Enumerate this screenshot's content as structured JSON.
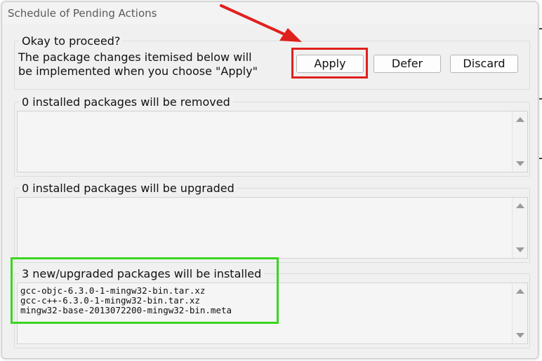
{
  "window": {
    "title": "Schedule of Pending Actions"
  },
  "confirm": {
    "legend": "Okay to proceed?",
    "message_line1": "The package changes itemised below will",
    "message_line2": "be implemented when you choose \"Apply\"",
    "buttons": {
      "apply": "Apply",
      "defer": "Defer",
      "discard": "Discard"
    }
  },
  "removed": {
    "legend": "0 installed packages will be removed",
    "items": []
  },
  "upgraded": {
    "legend": "0 installed packages will be upgraded",
    "items": []
  },
  "installed": {
    "legend": "3 new/upgraded packages will be installed",
    "items": [
      "gcc-objc-6.3.0-1-mingw32-bin.tar.xz",
      "gcc-c++-6.3.0-1-mingw32-bin.tar.xz",
      "mingw32-base-2013072200-mingw32-bin.meta"
    ]
  },
  "annotations": {
    "red_highlight_color": "#e0201d",
    "green_highlight_color": "#3ad61f",
    "arrow_color": "#e0201d"
  }
}
